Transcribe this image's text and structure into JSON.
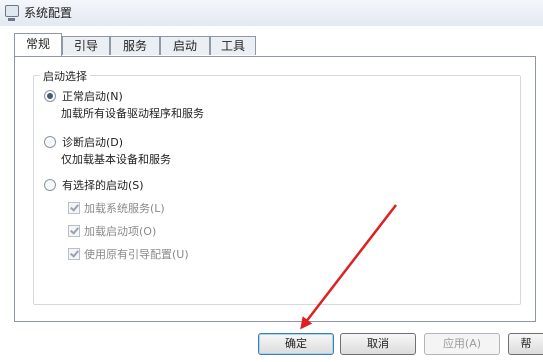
{
  "window": {
    "title": "系统配置"
  },
  "tabs": [
    {
      "label": "常规",
      "active": true
    },
    {
      "label": "引导",
      "active": false
    },
    {
      "label": "服务",
      "active": false
    },
    {
      "label": "启动",
      "active": false
    },
    {
      "label": "工具",
      "active": false
    }
  ],
  "startup_selection": {
    "group_title": "启动选择",
    "options": [
      {
        "label": "正常启动(N)",
        "description": "加载所有设备驱动程序和服务",
        "checked": true
      },
      {
        "label": "诊断启动(D)",
        "description": "仅加载基本设备和服务",
        "checked": false
      },
      {
        "label": "有选择的启动(S)",
        "checked": false
      }
    ],
    "selective_items": [
      {
        "label": "加载系统服务(L)",
        "checked": true
      },
      {
        "label": "加载启动项(O)",
        "checked": true
      },
      {
        "label": "使用原有引导配置(U)",
        "checked": true
      }
    ]
  },
  "buttons": {
    "ok": "确定",
    "cancel": "取消",
    "apply": "应用(A)",
    "help": "帮"
  },
  "annotation": {
    "color": "#e02020"
  }
}
